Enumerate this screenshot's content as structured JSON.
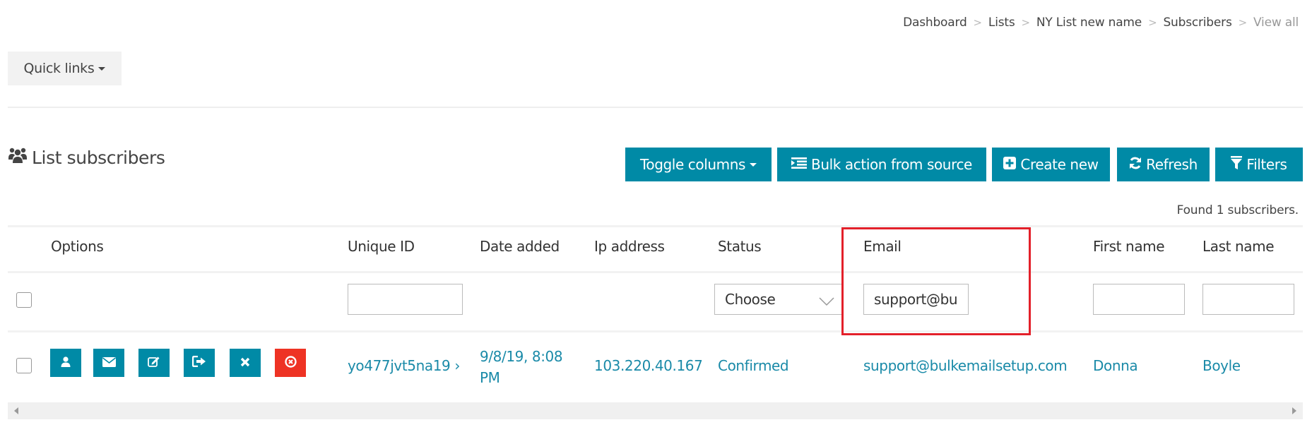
{
  "breadcrumb": [
    {
      "label": "Dashboard"
    },
    {
      "label": "Lists"
    },
    {
      "label": "NY List new name"
    },
    {
      "label": "Subscribers"
    },
    {
      "label": "View all",
      "active": true
    }
  ],
  "breadcrumb_separator": ">",
  "quick_links": {
    "label": "Quick links",
    "icon": "caret-down-icon"
  },
  "section": {
    "title": "List subscribers",
    "icon": "users-icon"
  },
  "toolbar": {
    "toggle_columns": "Toggle columns",
    "bulk_action": "Bulk action from source",
    "create_new": "Create new",
    "refresh": "Refresh",
    "filters": "Filters"
  },
  "found_text": "Found 1 subscribers.",
  "table": {
    "columns": [
      "Options",
      "Unique ID",
      "Date added",
      "Ip address",
      "Status",
      "Email",
      "First name",
      "Last name"
    ],
    "filters": {
      "unique_id": "",
      "status": "Choose",
      "email": "support@bulke",
      "first_name": "",
      "last_name": ""
    },
    "rows": [
      {
        "unique_id": "yo477jvt5na19",
        "unique_id_suffix": "›",
        "date_added_line1": "9/8/19, 8:08",
        "date_added_line2": "PM",
        "ip_address": "103.220.40.167",
        "status": "Confirmed",
        "email": "support@bulkemailsetup.com",
        "first_name": "Donna",
        "last_name": "Boyle",
        "actions": [
          "profile-icon",
          "email-icon",
          "edit-icon",
          "unsubscribe-icon",
          "delete-icon",
          "blacklist-icon"
        ]
      }
    ]
  },
  "colors": {
    "primary": "#008aa6",
    "danger": "#ee3324",
    "link": "#1a8aa8",
    "highlight": "#e3202a"
  }
}
